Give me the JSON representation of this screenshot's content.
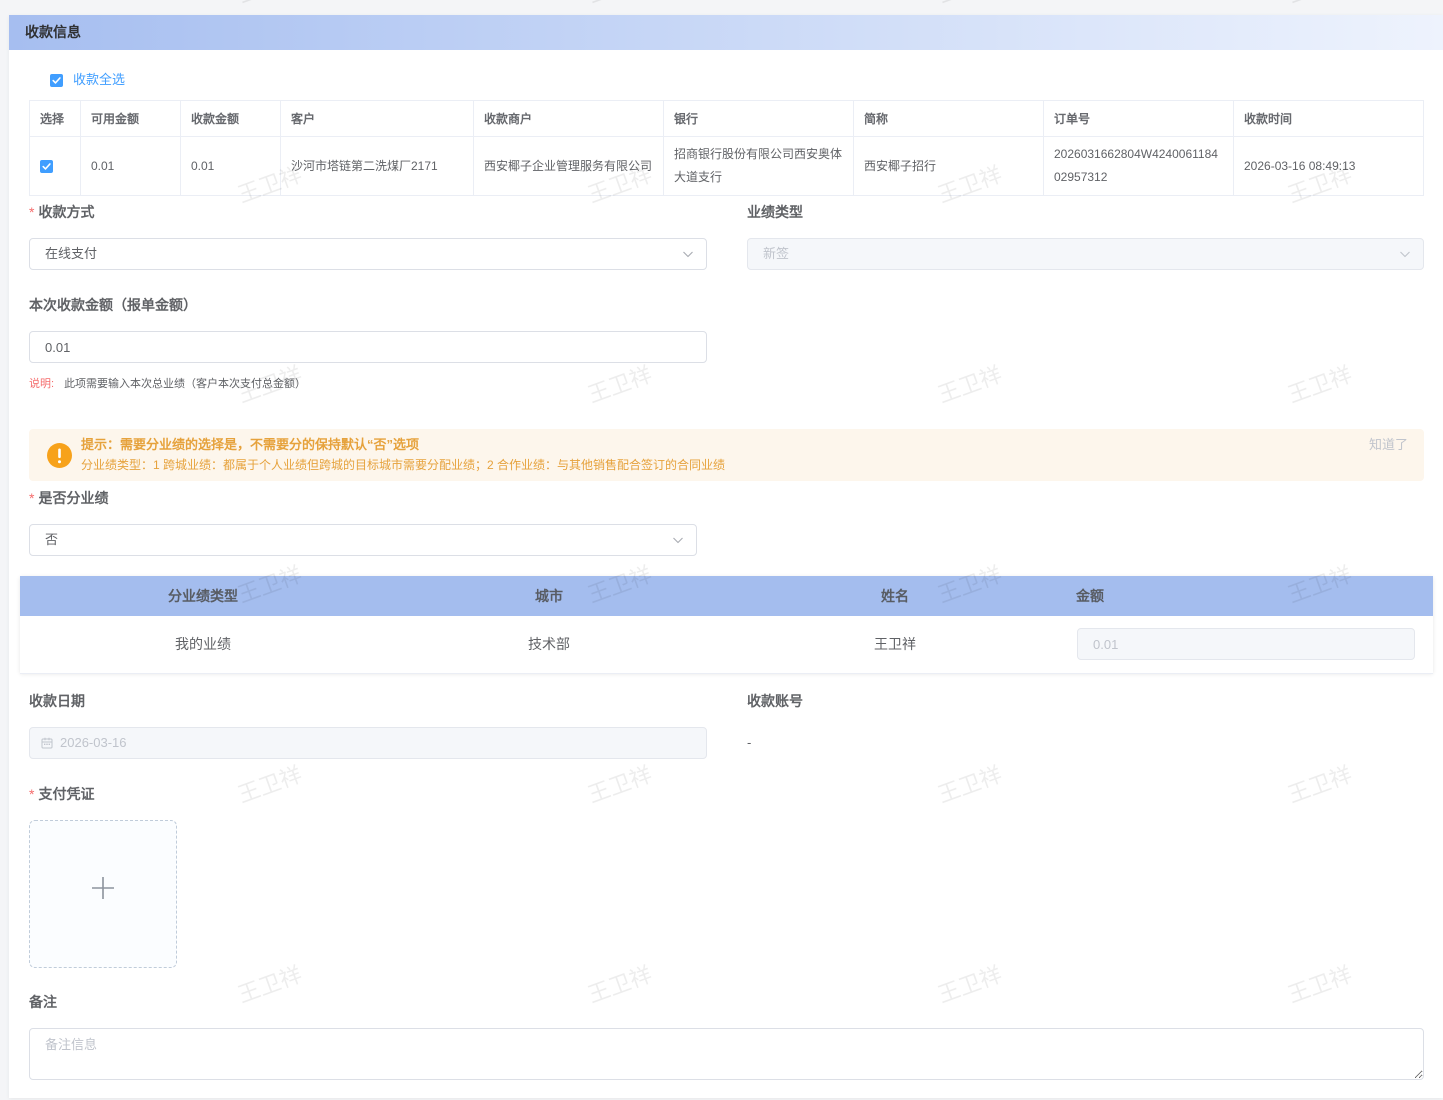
{
  "section": {
    "title": "收款信息"
  },
  "required_mark": "*",
  "select_all": {
    "label": "收款全选",
    "checked": true
  },
  "receipts_table": {
    "columns": [
      "选择",
      "可用金额",
      "收款金额",
      "客户",
      "收款商户",
      "银行",
      "简称",
      "订单号",
      "收款时间"
    ],
    "rows": [
      {
        "selected": true,
        "available_amount": "0.01",
        "receipt_amount": "0.01",
        "customer": "沙河市塔链第二洗煤厂2171",
        "merchant": "西安椰子企业管理服务有限公司",
        "bank": "招商银行股份有限公司西安奥体大道支行",
        "short_name": "西安椰子招行",
        "order_no": "2026031662804W424006118402957312",
        "received_at": "2026-03-16 08:49:13"
      }
    ]
  },
  "payment_method": {
    "label": "收款方式",
    "value": "在线支付"
  },
  "performance_type": {
    "label": "业绩类型",
    "value": "新签"
  },
  "amount": {
    "label": "本次收款金额（报单金额）",
    "value": "0.01"
  },
  "amount_hint": {
    "prefix": "说明:",
    "text": "此项需要输入本次总业绩（客户本次支付总金额）"
  },
  "alert": {
    "title": "提示：需要分业绩的选择是，不需要分的保持默认“否”选项",
    "description": "分业绩类型：1 跨城业绩：都属于个人业绩但跨城的目标城市需要分配业绩；2 合作业绩：与其他销售配合签订的合同业绩",
    "dismiss": "知道了"
  },
  "split_performance": {
    "label": "是否分业绩",
    "value": "否"
  },
  "split_table": {
    "columns": [
      "分业绩类型",
      "城市",
      "姓名",
      "金额"
    ],
    "rows": [
      {
        "type": "我的业绩",
        "city": "技术部",
        "name": "王卫祥",
        "amount": "0.01"
      }
    ]
  },
  "receipt_date": {
    "label": "收款日期",
    "value": "2026-03-16"
  },
  "receipt_account": {
    "label": "收款账号",
    "value": "-"
  },
  "payment_voucher": {
    "label": "支付凭证"
  },
  "remark": {
    "label": "备注",
    "placeholder": "备注信息"
  },
  "watermark": {
    "text": "王卫祥"
  },
  "icons": {
    "checkbox": "checkbox-checked-icon",
    "select_arrow": "chevron-down-icon",
    "alert": "warning-icon",
    "date": "calendar-icon",
    "upload": "plus-icon"
  },
  "colors": {
    "accent": "#409eff",
    "warning": "#e6a23c",
    "danger": "#f56c6c",
    "section_header_start": "#a6bef0",
    "section_header_end": "#eef3fd",
    "split_table_header": "#a4bdee",
    "alert_background": "#fdf6ec"
  }
}
